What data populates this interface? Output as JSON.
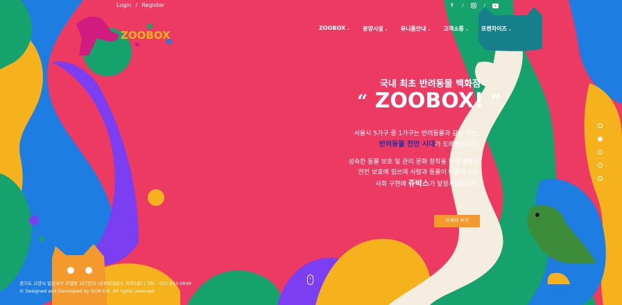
{
  "top_links": {
    "login": "Login",
    "divider": "/",
    "register": "Register"
  },
  "social": {
    "icons": [
      "facebook-icon",
      "instagram-icon",
      "youtube-icon"
    ],
    "divider": "/"
  },
  "logo": {
    "text": "ZOOBOX"
  },
  "nav": [
    {
      "label": "ZOOBOX"
    },
    {
      "label": "분양시설"
    },
    {
      "label": "유니폼안내"
    },
    {
      "label": "고객소통"
    },
    {
      "label": "프랜차이즈"
    }
  ],
  "hero": {
    "subtitle": "국내 최초 반려동물 백화점",
    "title": "ZOOBOX!",
    "quote_open": "“",
    "quote_close": "”",
    "para1_line1": "서울시 5가구 중 1가구는 반려동물과 같이 사는,",
    "para1_highlight": "반려동물 천만 시대",
    "para1_tail": "가 도래했습니다.",
    "para2_line1": "성숙한 동물 보호 및 관리 문화 정착을 위해 생명과",
    "para2_line2": "안전 보호에 힘쓰며 사람과 동물이 더불어 사는",
    "para2_line3a": "사회 구현에 ",
    "para2_brand": "쥬박스",
    "para2_line3b": "가 앞장서겠습니다.",
    "button": "자세히 보기"
  },
  "slider": {
    "count": 5,
    "active_index": 1
  },
  "footer": {
    "address": "경기도 고양시 일산서구 주엽동 107번지 (삼부르네상스 지하1층) | TEL : 031-913-0649",
    "credit": "© Designed and Developed by DCM Ent. All rights reserved."
  },
  "colors": {
    "background": "#ec3a63",
    "yellow": "#f6b21c",
    "blue": "#1e7de0",
    "purple": "#7b3ef0",
    "green": "#16a26c",
    "cream": "#f5ede0",
    "orange": "#f49a2c",
    "highlight": "#2b2fa0"
  }
}
